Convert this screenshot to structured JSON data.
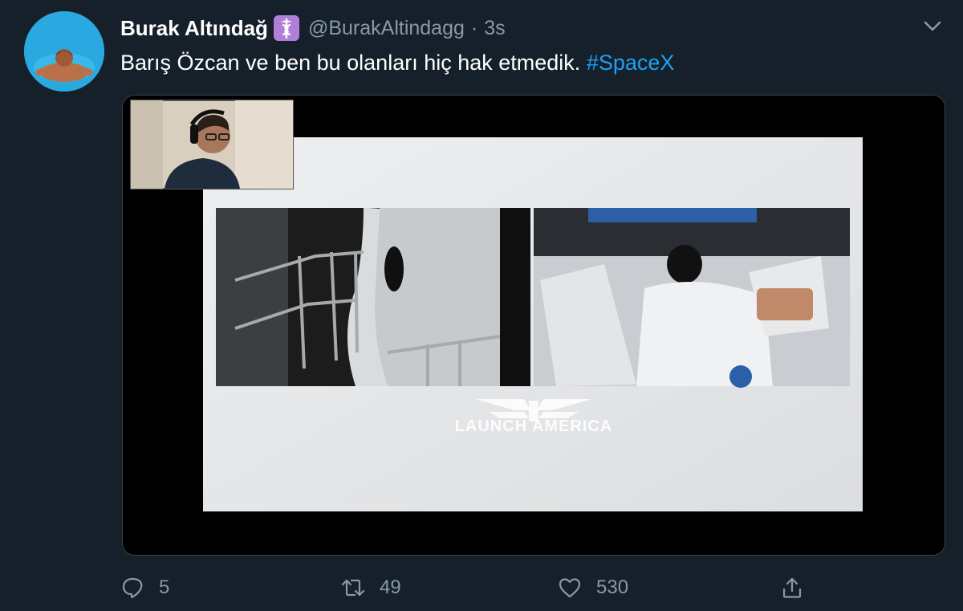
{
  "tweet": {
    "author_name": "Burak Altındağ",
    "author_handle": "@BurakAltindagg",
    "separator": "·",
    "timestamp": "3s",
    "text": "Barış Özcan ve ben bu olanları hiç hak etmedik.",
    "hashtag": "#SpaceX"
  },
  "media": {
    "overlay_text": "LAUNCH AMERICA"
  },
  "actions": {
    "replies": "5",
    "retweets": "49",
    "likes": "530"
  },
  "icons": {
    "badge": "medical-caduceus-icon",
    "menu": "chevron-down-icon",
    "reply": "reply-icon",
    "retweet": "retweet-icon",
    "like": "heart-icon",
    "share": "share-icon"
  },
  "colors": {
    "background": "#15202b",
    "secondary_text": "#8899a6",
    "link": "#1da1f2",
    "avatar_bg": "#2aa9e0",
    "badge_bg": "#b07fd8"
  }
}
